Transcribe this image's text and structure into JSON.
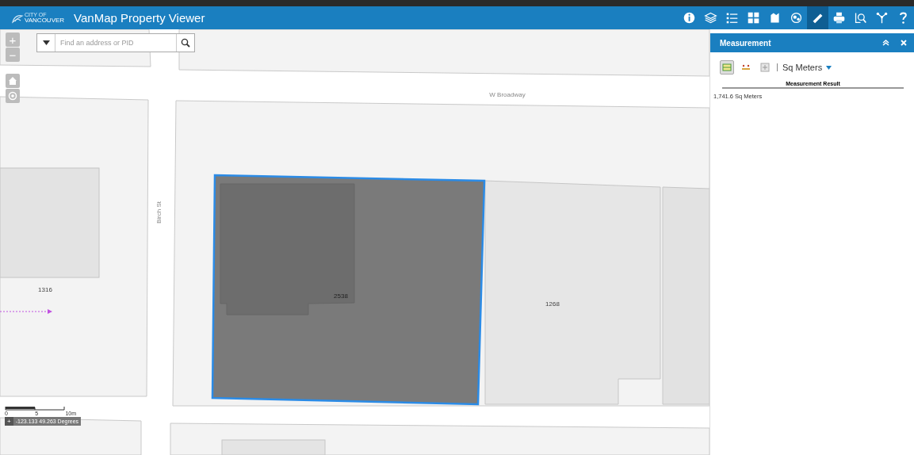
{
  "header": {
    "logo_top": "CITY OF",
    "logo_bottom": "VANCOUVER",
    "title": "VanMap Property Viewer",
    "tools": [
      {
        "kind": "info",
        "selected": false
      },
      {
        "kind": "layers",
        "selected": false
      },
      {
        "kind": "legend",
        "selected": false
      },
      {
        "kind": "basemap",
        "selected": false
      },
      {
        "kind": "bookmark",
        "selected": false
      },
      {
        "kind": "globe",
        "selected": false
      },
      {
        "kind": "measure",
        "selected": true
      },
      {
        "kind": "print",
        "selected": false
      },
      {
        "kind": "query",
        "selected": false
      },
      {
        "kind": "share",
        "selected": false
      },
      {
        "kind": "help",
        "selected": false
      }
    ]
  },
  "search": {
    "placeholder": "Find an address or PID"
  },
  "zoom": {
    "in": "+",
    "out": "−"
  },
  "map": {
    "streets": [
      {
        "kind": "horizontal",
        "label": "W Broadway"
      },
      {
        "kind": "vertical",
        "label": "Birch St"
      }
    ],
    "parcels": [
      {
        "label": "1316",
        "selected": false
      },
      {
        "label": "2538",
        "selected": true
      },
      {
        "label": "1268",
        "selected": false
      }
    ],
    "scale": {
      "ticks": [
        "0",
        "5",
        "10m"
      ]
    },
    "coordinates": {
      "toggle": "+",
      "value": "-123.133 49.263 Degrees"
    }
  },
  "panel": {
    "title": "Measurement",
    "modes": [
      {
        "kind": "area",
        "selected": true
      },
      {
        "kind": "distance",
        "selected": false
      },
      {
        "kind": "location",
        "selected": false
      }
    ],
    "unit": "Sq Meters",
    "result_heading": "Measurement Result",
    "result": "1,741.6 Sq Meters"
  }
}
